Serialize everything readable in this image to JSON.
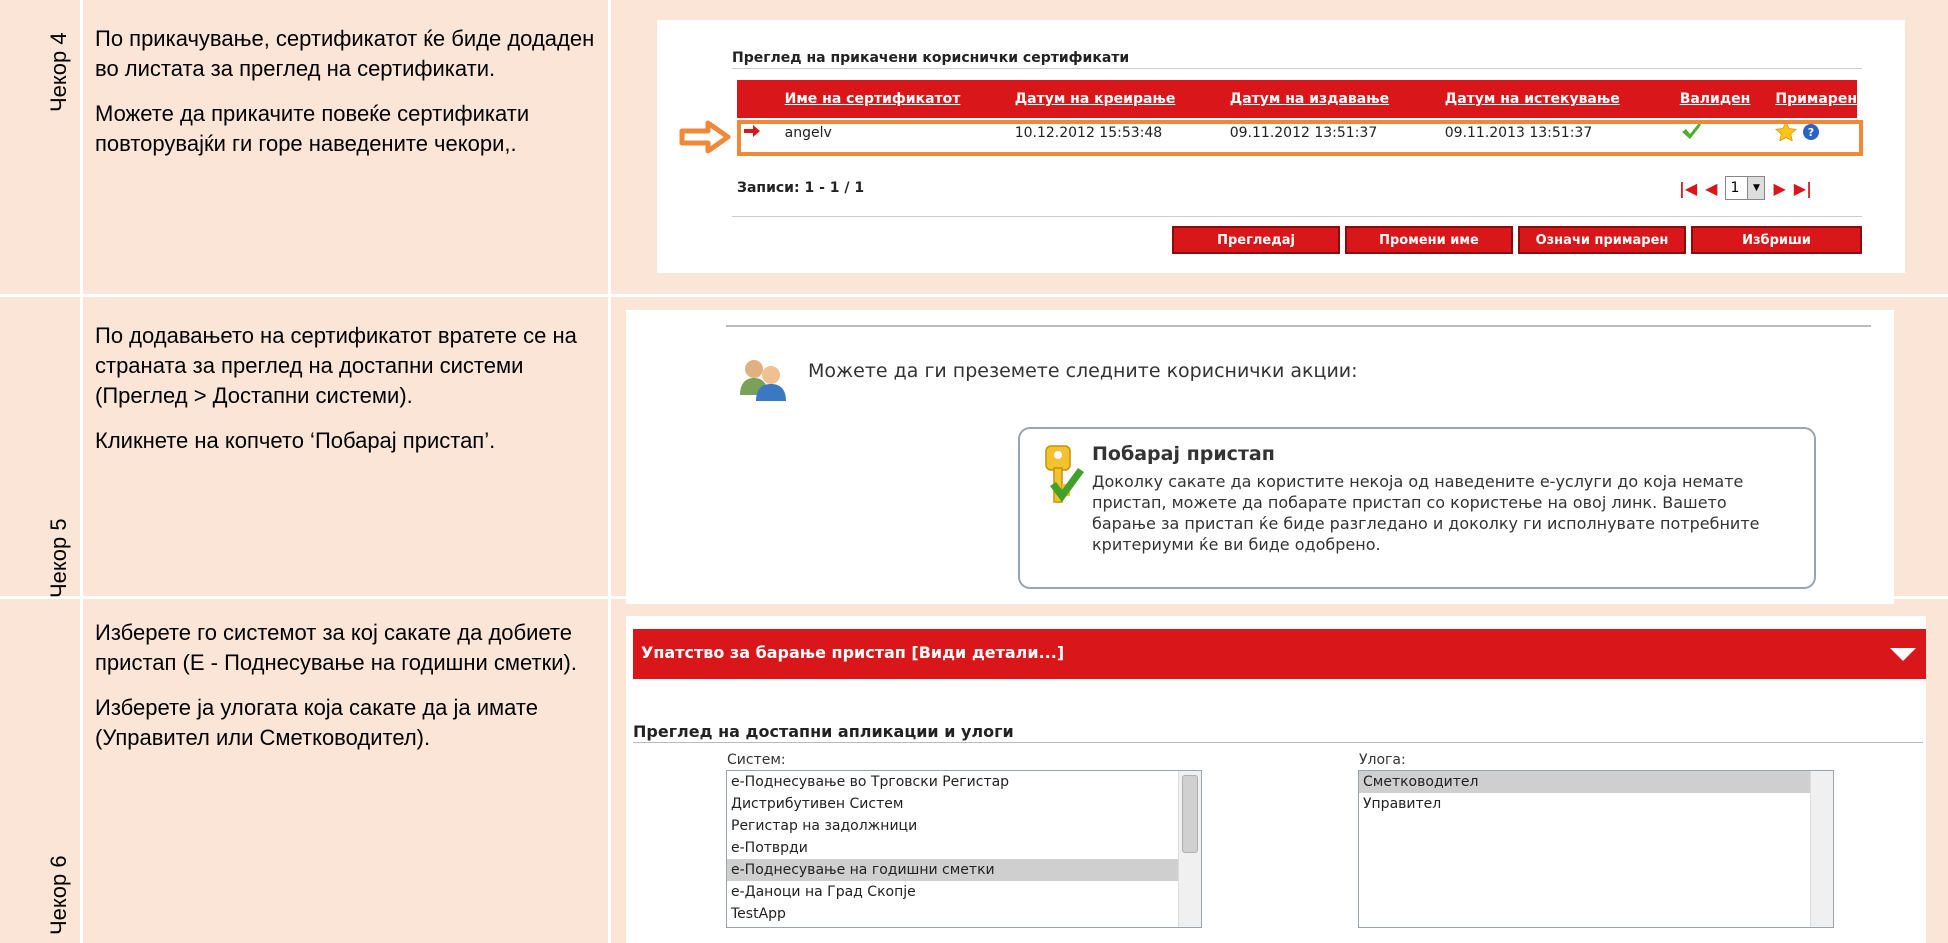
{
  "steps": {
    "s4": {
      "label": "Чекор 4",
      "paragraphs": [
        "По прикачување, сертификатот ќе биде додаден во листата за преглед на сертификати.",
        "Можете да прикачите повеќе сертификати повторувајќи ги горе наведените чекори,."
      ]
    },
    "s5": {
      "label": "Чекор 5",
      "paragraphs": [
        "По додавањето на сертификатот вратете се на страната за преглед на достапни системи (Преглед > Достапни системи).",
        "Кликнете на копчето ‘Побарај пристап’."
      ]
    },
    "s6": {
      "label": "Чекор 6",
      "paragraphs": [
        "Изберете го системот за кој сакате да добиете пристап (Е - Поднесување на годишни сметки).",
        "Изберете ја улогата која сакате да ја имате (Управител или Сметководител)."
      ]
    }
  },
  "certs": {
    "title": "Преглед на прикачени кориснички сертификати",
    "headers": {
      "name": "Име на сертификатот",
      "created": "Датум на креирање",
      "issued": "Датум на издавање",
      "expires": "Датум на истекување",
      "valid": "Валиден",
      "primary": "Примарен"
    },
    "row": {
      "name": "angelv",
      "created": "10.12.2012 15:53:48",
      "issued": "09.11.2012 13:51:37",
      "expires": "09.11.2013 13:51:37"
    },
    "records": "Записи: 1 - 1 / 1",
    "page": "1",
    "buttons": {
      "view": "Прегледај",
      "rename": "Промени име",
      "primary": "Означи примарен",
      "delete": "Избриши"
    },
    "colors": {
      "accent": "#d9171a",
      "highlight": "#f08838"
    }
  },
  "access": {
    "intro": "Можете да ги преземете следните кориснички акции:",
    "box_title": "Побарај пристап",
    "box_body": "Доколку сакате да користите некоја од наведените е-услуги до која немате пристап, можете да побарате пристап со користење на овој линк. Вашето барање за пристап ќе биде разгледано и доколку ги исполнувате потребните критериуми ќе ви биде одобрено."
  },
  "apps": {
    "banner": "Упатство за барање пристап  [Види детали...]",
    "section": "Преглед на достапни апликации и улоги",
    "system_label": "Систем:",
    "role_label": "Улога:",
    "systems": [
      "е-Поднесување во Трговски Регистар",
      "Дистрибутивен Систем",
      "Регистар на задолжници",
      "е-Потврди",
      "е-Поднесување на годишни сметки",
      "е-Даноци на Град Скопје",
      "TestApp"
    ],
    "selected_system": "е-Поднесување на годишни сметки",
    "roles": [
      "Сметководител",
      "Управител"
    ],
    "selected_role": "Сметководител"
  }
}
